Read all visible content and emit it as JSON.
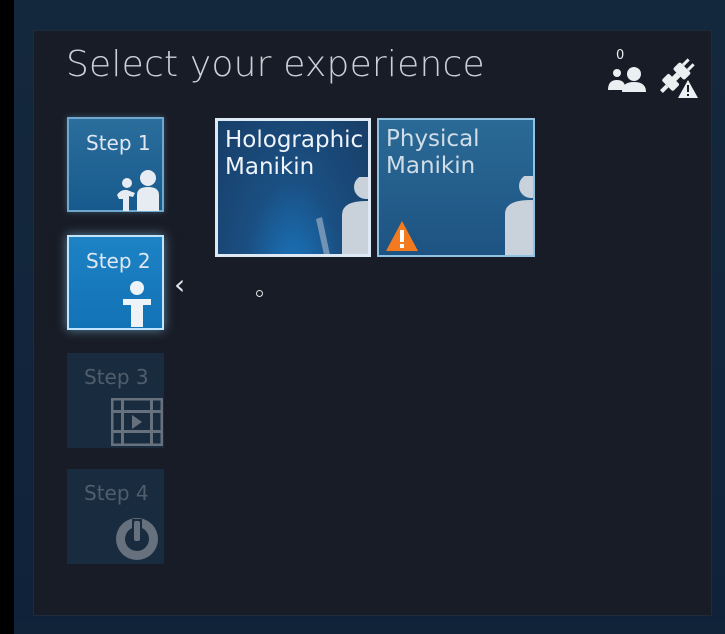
{
  "header": {
    "title": "Select your experience",
    "connected_count": "0"
  },
  "icons": {
    "users": "users-icon",
    "connection": "plug-warning-icon"
  },
  "steps": [
    {
      "label": "Step 1",
      "icon": "people-icon",
      "state": "completed"
    },
    {
      "label": "Step 2",
      "icon": "person-icon",
      "state": "active"
    },
    {
      "label": "Step 3",
      "icon": "film-play-icon",
      "state": "disabled"
    },
    {
      "label": "Step 4",
      "icon": "power-icon",
      "state": "disabled"
    }
  ],
  "experiences": [
    {
      "label": "Holographic Manikin",
      "line1": "Holographic",
      "line2": "Manikin",
      "selected": true
    },
    {
      "label": "Physical Manikin",
      "line1": "Physical",
      "line2": "Manikin",
      "warning": true
    }
  ],
  "colors": {
    "background": "#181c26",
    "accent_active": "#1272b6",
    "warning": "#f47a20"
  }
}
